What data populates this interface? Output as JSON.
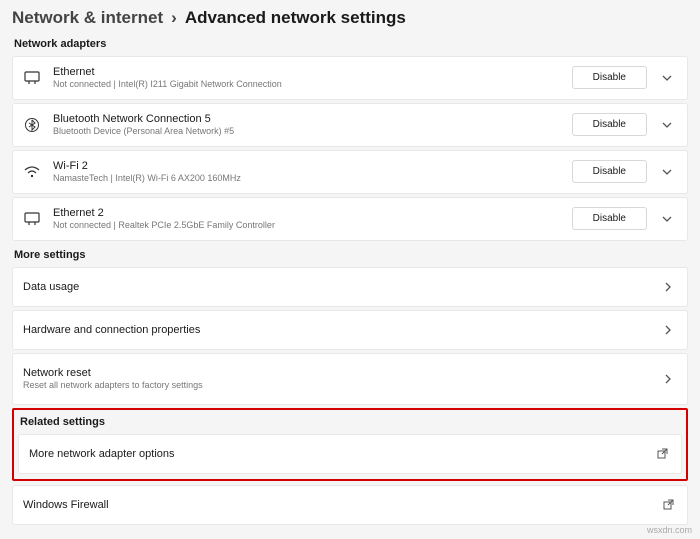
{
  "breadcrumb": {
    "parent": "Network & internet",
    "sep": "›",
    "current": "Advanced network settings"
  },
  "sections": {
    "adapters_label": "Network adapters",
    "more_settings_label": "More settings",
    "related_label": "Related settings"
  },
  "adapters": [
    {
      "name": "Ethernet",
      "sub": "Not connected | Intel(R) I211 Gigabit Network Connection",
      "action": "Disable",
      "icon": "ethernet"
    },
    {
      "name": "Bluetooth Network Connection 5",
      "sub": "Bluetooth Device (Personal Area Network) #5",
      "action": "Disable",
      "icon": "bluetooth"
    },
    {
      "name": "Wi-Fi 2",
      "sub": "NamasteTech | Intel(R) Wi-Fi 6 AX200 160MHz",
      "action": "Disable",
      "icon": "wifi"
    },
    {
      "name": "Ethernet 2",
      "sub": "Not connected | Realtek PCIe 2.5GbE Family Controller",
      "action": "Disable",
      "icon": "ethernet"
    }
  ],
  "more_settings": [
    {
      "title": "Data usage"
    },
    {
      "title": "Hardware and connection properties"
    },
    {
      "title": "Network reset",
      "sub": "Reset all network adapters to factory settings"
    }
  ],
  "related": [
    {
      "title": "More network adapter options",
      "external": true
    }
  ],
  "bottom": [
    {
      "title": "Windows Firewall",
      "external": true
    }
  ],
  "watermark": "wsxdn.com"
}
